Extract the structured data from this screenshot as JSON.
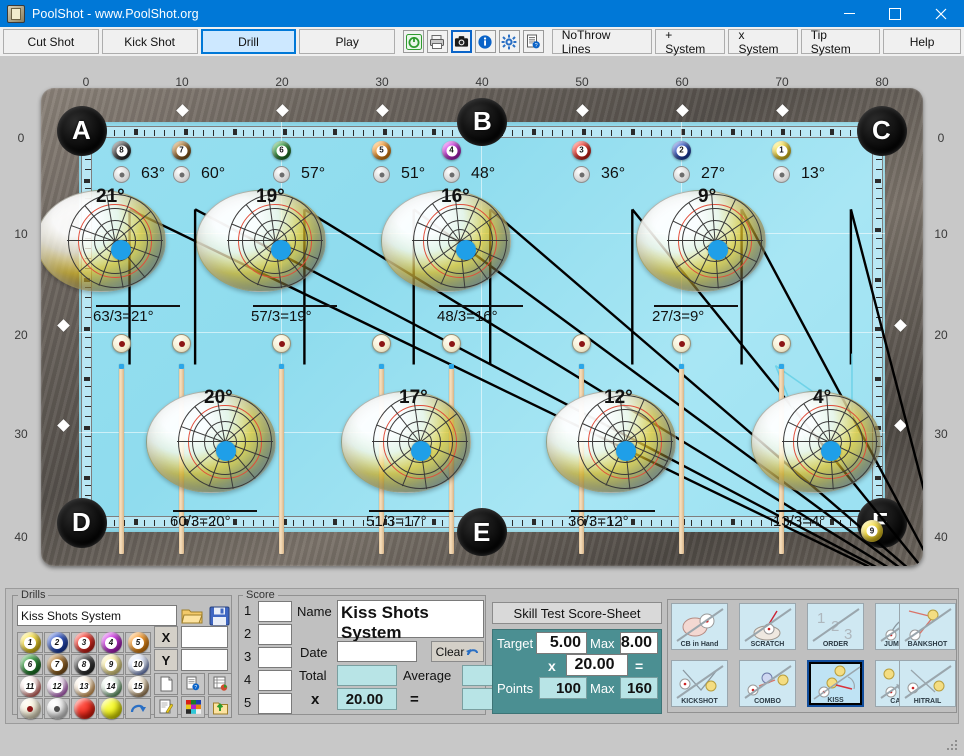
{
  "window": {
    "title": "PoolShot - www.PoolShot.org",
    "icon": "poolshot-app-icon",
    "minimize": "—",
    "maximize": "□",
    "close": "✕"
  },
  "toolbar": {
    "tabs": [
      {
        "label": "Cut Shot",
        "selected": false
      },
      {
        "label": "Kick Shot",
        "selected": false
      },
      {
        "label": "Drill",
        "selected": true
      },
      {
        "label": "Play",
        "selected": false
      }
    ],
    "icons": [
      {
        "name": "power-icon",
        "glyph": "⏻"
      },
      {
        "name": "print-icon",
        "glyph": "⎙"
      },
      {
        "name": "camera-icon",
        "glyph": "◉"
      },
      {
        "name": "info-icon",
        "glyph": "i"
      },
      {
        "name": "gear-icon",
        "glyph": "⚙"
      },
      {
        "name": "help-doc-icon",
        "glyph": "?"
      }
    ],
    "systems": [
      {
        "label": "NoThrow Lines"
      },
      {
        "label": "+ System"
      },
      {
        "label": "x System"
      },
      {
        "label": "Tip System"
      },
      {
        "label": "Help"
      }
    ]
  },
  "table": {
    "top_ruler_labels": [
      "0",
      "10",
      "20",
      "30",
      "40",
      "50",
      "60",
      "70",
      "80"
    ],
    "left_ruler_labels": [
      "0",
      "10",
      "20",
      "30",
      "40"
    ],
    "right_ruler_labels": [
      "0",
      "10",
      "20",
      "30",
      "40"
    ],
    "pockets": [
      {
        "label": "A"
      },
      {
        "label": "B"
      },
      {
        "label": "C"
      },
      {
        "label": "D"
      },
      {
        "label": "E"
      },
      {
        "label": "F"
      }
    ],
    "object_balls": [
      {
        "number": "8",
        "color": "#2b2b2b",
        "angle": "63°"
      },
      {
        "number": "7",
        "color": "#8a5a1e",
        "angle": "60°"
      },
      {
        "number": "6",
        "color": "#1d7b27",
        "angle": "57°"
      },
      {
        "number": "5",
        "color": "#e8850f",
        "angle": "51°"
      },
      {
        "number": "4",
        "color": "#b51fc9",
        "angle": "48°"
      },
      {
        "number": "3",
        "color": "#d81f16",
        "angle": "36°"
      },
      {
        "number": "2",
        "color": "#1a3fae",
        "angle": "27°"
      },
      {
        "number": "1",
        "color": "#e8c81b",
        "angle": "13°"
      }
    ],
    "target_ball": {
      "number": "9",
      "color": "#e8c81b"
    },
    "cue_balls_row1": [
      {
        "angle": "21°",
        "formula": "63/3=21°"
      },
      {
        "angle": "19°",
        "formula": "57/3=19°"
      },
      {
        "angle": "16°",
        "formula": "48/3=16°"
      },
      {
        "angle": "9°",
        "formula": "27/3=9°"
      }
    ],
    "cue_balls_row2": [
      {
        "angle": "20°",
        "formula": "60/3=20°"
      },
      {
        "angle": "17°",
        "formula": "51/3=17°"
      },
      {
        "angle": "12°",
        "formula": "36/3=12°"
      },
      {
        "angle": "4°",
        "formula": "13/3=4°"
      }
    ]
  },
  "drills": {
    "group_label": "Drills",
    "name_value": "Kiss Shots System",
    "open_icon": "folder-open-icon",
    "save_icon": "floppy-save-icon",
    "x_label": "X",
    "y_label": "Y",
    "x_value": "",
    "y_value": "",
    "balls": [
      {
        "n": "1",
        "c": "#e8c81b"
      },
      {
        "n": "2",
        "c": "#1a3fae"
      },
      {
        "n": "3",
        "c": "#d81f16"
      },
      {
        "n": "4",
        "c": "#b51fc9"
      },
      {
        "n": "5",
        "c": "#e8850f"
      },
      {
        "n": "6",
        "c": "#1d7b27"
      },
      {
        "n": "7",
        "c": "#8a5a1e"
      },
      {
        "n": "8",
        "c": "#2b2b2b"
      },
      {
        "n": "9",
        "c": "#e8c81b"
      },
      {
        "n": "10",
        "c": "#1a3fae"
      },
      {
        "n": "11",
        "c": "#d81f16"
      },
      {
        "n": "12",
        "c": "#b51fc9"
      },
      {
        "n": "13",
        "c": "#e8850f"
      },
      {
        "n": "14",
        "c": "#1d7b27"
      },
      {
        "n": "15",
        "c": "#8a5a1e"
      }
    ],
    "special": [
      {
        "name": "red-dot-ball"
      },
      {
        "name": "grey-dot-ball"
      },
      {
        "name": "red-ball"
      },
      {
        "name": "yellow-ball"
      },
      {
        "name": "reset-arrow-icon"
      }
    ],
    "tools": [
      {
        "name": "new-page-icon"
      },
      {
        "name": "page-help-icon"
      },
      {
        "name": "table-report-icon"
      },
      {
        "name": "edit-note-icon"
      },
      {
        "name": "color-palette-icon"
      },
      {
        "name": "export-folder-icon"
      }
    ]
  },
  "score": {
    "group_label": "Score",
    "rows": [
      "1",
      "2",
      "3",
      "4",
      "5"
    ],
    "row_values": [
      "",
      "",
      "",
      "",
      ""
    ],
    "name_label": "Name",
    "name_value": "Kiss Shots System",
    "date_label": "Date",
    "date_value": "",
    "clear_label": "Clear",
    "clear_icon": "undo-arrow-icon",
    "total_label": "Total",
    "total_value": "",
    "average_label": "Average",
    "average_value": "",
    "multiply_label": "x",
    "multiplier_value": "20.00",
    "equals_label": "=",
    "result_value": ""
  },
  "skill": {
    "title": "Skill Test Score-Sheet",
    "target_label": "Target",
    "target_value": "5.00",
    "max_label_1": "Max",
    "max_value_1": "8.00",
    "multiply_label": "x",
    "multiplier_value": "20.00",
    "equals_label": "=",
    "points_label": "Points",
    "points_value": "100",
    "max_label_2": "Max",
    "max_value_2": "160",
    "panel_color": "#4b8f92"
  },
  "shot_modes": [
    {
      "label": "CB in Hand",
      "icon": "cb-in-hand-icon",
      "selected": false
    },
    {
      "label": "SCRATCH",
      "icon": "scratch-icon",
      "selected": false
    },
    {
      "label": "ORDER",
      "icon": "order-123-icon",
      "selected": false
    },
    {
      "label": "JUMPSHOT",
      "icon": "jumpshot-icon",
      "selected": false
    },
    {
      "label": "BANKSHOT",
      "icon": "bankshot-icon",
      "selected": false
    },
    {
      "label": "KICKSHOT",
      "icon": "kickshot-icon",
      "selected": false
    },
    {
      "label": "COMBO",
      "icon": "combo-icon",
      "selected": false
    },
    {
      "label": "KISS",
      "icon": "kiss-icon",
      "selected": true
    },
    {
      "label": "CAROM",
      "icon": "carom-icon",
      "selected": false
    },
    {
      "label": "HITRAIL",
      "icon": "hitrail-icon",
      "selected": false
    }
  ]
}
